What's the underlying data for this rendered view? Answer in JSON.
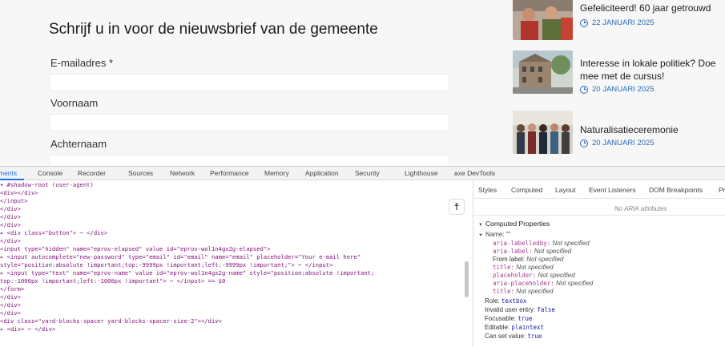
{
  "form": {
    "title": "Schrijf u in voor de nieuwsbrief van de gemeente",
    "email_label": "E-mailadres *",
    "firstname_label": "Voornaam",
    "lastname_label": "Achternaam"
  },
  "news": [
    {
      "title": "Gefeliciteerd! 60 jaar getrouwd",
      "date": "22 JANUARI 2025"
    },
    {
      "title": "Interesse in lokale politiek? Doe mee met de cursus!",
      "date": "20 JANUARI 2025"
    },
    {
      "title": "Naturalisatieceremonie",
      "date": "20 JANUARI 2025"
    }
  ],
  "devtools": {
    "tabs": [
      "ments",
      "Console",
      "Recorder",
      "Sources",
      "Network",
      "Performance",
      "Memory",
      "Application",
      "Security",
      "Lighthouse",
      "axe DevTools"
    ],
    "side_tabs": [
      "Styles",
      "Computed",
      "Layout",
      "Event Listeners",
      "DOM Breakpoints",
      "Pr"
    ],
    "accessibility_icon": "accessibility-icon",
    "no_aria": "No ARIA attributes",
    "computed_properties": "Computed Properties",
    "name_line": "Name: \"\"",
    "props": [
      {
        "key": "aria-labelledby:",
        "value": "Not specified"
      },
      {
        "key": "aria-label:",
        "value": "Not specified"
      },
      {
        "key": "From label:",
        "value": "Not specified"
      },
      {
        "key": "title:",
        "value": "Not specified"
      },
      {
        "key": "placeholder:",
        "value": "Not specified"
      },
      {
        "key": "aria-placeholder:",
        "value": "Not specified"
      },
      {
        "key": "title:",
        "value": "Not specified"
      }
    ],
    "role": {
      "key": "Role:",
      "value": "textbox"
    },
    "invalid": {
      "key": "Invalid user entry:",
      "value": "false"
    },
    "focusable": {
      "key": "Focusable:",
      "value": "true"
    },
    "editable": {
      "key": "Editable:",
      "value": "plaintext"
    },
    "can_set": {
      "key": "Can set value:",
      "value": "true"
    },
    "dom_lines": [
      "          ▾ #shadow-root (user-agent)",
      "              <div></div>",
      "            </input>",
      "          </div>",
      "        </div>",
      "      </div>",
      "    ▸ <div class=\"button\"> ⋯ </div>",
      "    </div>",
      "    <input type=\"hidden\" name=\"eprov-elapsed\" value id=\"eprov-wol1n4gx2g-elapsed\">",
      "  ▸ <input autocomplete=\"new-password\" type=\"email\" id=\"email\" name=\"email\" placeholder=\"Your e-mail here\"",
      "    style=\"position:absolute !important;top:-9999px !important;left:-9999px !important;\"> ⋯ </input>",
      "  ▸ <input type=\"text\" name=\"eprov-name\" value id=\"eprov-wol1n4gx2g-name\" style=\"position:absolute !important;",
      "    top:-1000px !important;left:-1000px !important\"> ⋯ </input> == $0",
      "    </form>",
      "  </div>",
      "  </div>",
      "</div>",
      "<div class=\"yard-blocks-spacer yard-blocks-spacer-size-2\"></div>",
      "▸ <div> ⋯ </div>"
    ]
  }
}
